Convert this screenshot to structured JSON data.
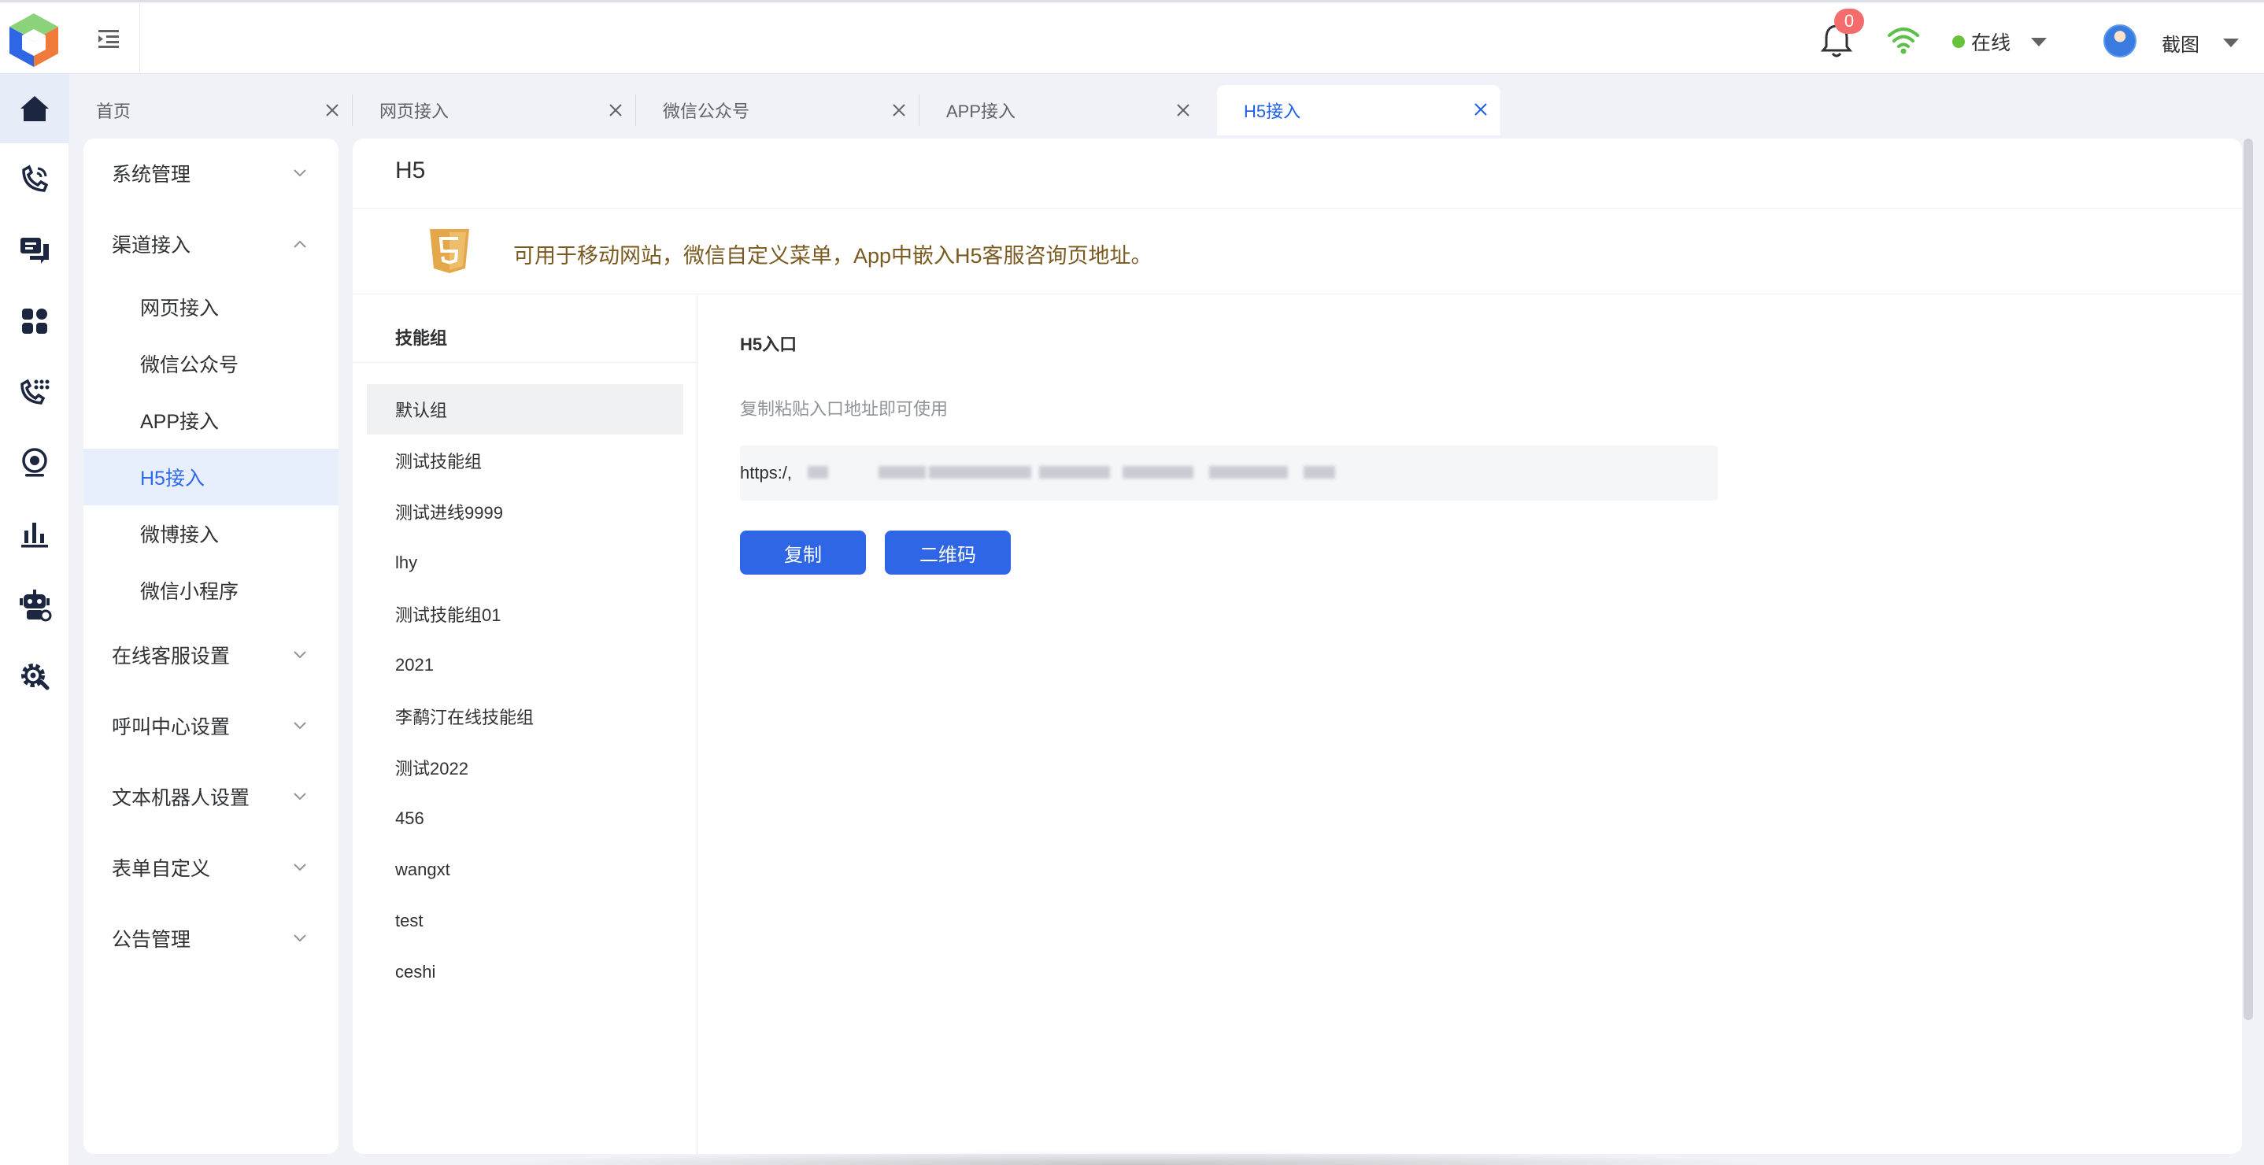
{
  "header": {
    "notification_count": "0",
    "status_label": "在线",
    "user_name": "截图"
  },
  "tabs": [
    {
      "label": "首页"
    },
    {
      "label": "网页接入"
    },
    {
      "label": "微信公众号"
    },
    {
      "label": "APP接入"
    },
    {
      "label": "H5接入"
    }
  ],
  "menu": {
    "items": [
      {
        "label": "系统管理"
      },
      {
        "label": "渠道接入"
      },
      {
        "label": "网页接入"
      },
      {
        "label": "微信公众号"
      },
      {
        "label": "APP接入"
      },
      {
        "label": "H5接入"
      },
      {
        "label": "微博接入"
      },
      {
        "label": "微信小程序"
      },
      {
        "label": "在线客服设置"
      },
      {
        "label": "呼叫中心设置"
      },
      {
        "label": "文本机器人设置"
      },
      {
        "label": "表单自定义"
      },
      {
        "label": "公告管理"
      }
    ]
  },
  "page": {
    "title": "H5",
    "notice": "可用于移动网站，微信自定义菜单，App中嵌入H5客服咨询页地址。"
  },
  "groups": {
    "header": "技能组",
    "items": [
      "默认组",
      "测试技能组",
      "测试进线9999",
      "lhy",
      "测试技能组01",
      "2021",
      "李鹬汀在线技能组",
      "测试2022",
      "456",
      "wangxt",
      "test",
      "ceshi"
    ]
  },
  "entry": {
    "title": "H5入口",
    "hint": "复制粘贴入口地址即可使用",
    "url_prefix": "https:/,",
    "copy_label": "复制",
    "qrcode_label": "二维码"
  },
  "colors": {
    "primary": "#2f66e6",
    "active_menu_bg": "#e7eefc",
    "online": "#67c23a",
    "badge": "#f56c6c"
  }
}
